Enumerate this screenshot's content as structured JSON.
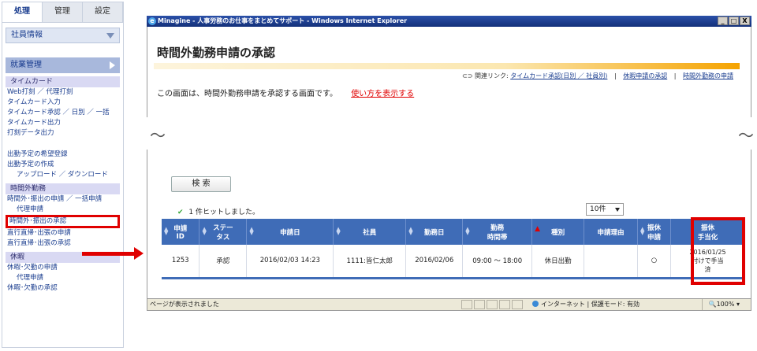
{
  "sidebar": {
    "tabs": [
      "処理",
      "管理",
      "設定"
    ],
    "employee_info": "社員情報",
    "work_management": "就業管理",
    "categories": {
      "timecard": "タイムカード",
      "overtime": "時間外勤務",
      "direct": "",
      "leave": "休暇"
    },
    "timecard_links": [
      "Web打刻 ／ 代理打刻",
      "タイムカード入力",
      "タイムカード承認 ／ 日別 ／ 一括",
      "タイムカード出力",
      "打刻データ出力"
    ],
    "schedule_links": [
      "出勤予定の希望登録",
      "出勤予定の作成",
      "アップロード ／ ダウンロード"
    ],
    "overtime_links": [
      "時間外･振出の申請 ／ 一括申請",
      "代理申請",
      "時間外･振出の承認",
      "直行直帰･出張の申請",
      "直行直帰･出張の承認"
    ],
    "leave_links": [
      "休暇･欠勤の申請",
      "代理申請",
      "休暇･欠勤の承認"
    ]
  },
  "window": {
    "title": "Minagine - 人事労務のお仕事をまとめてサポート - Windows Internet Explorer",
    "controls": [
      "_",
      "□",
      "X"
    ]
  },
  "page": {
    "title": "時間外勤務申請の承認",
    "related_label": "関連リンク:",
    "related_links": [
      "タイムカード承認(日別 ／ 社員別)",
      "休暇申請の承認",
      "時間外勤務の申請"
    ],
    "description": "この画面は、時間外勤務申請を承認する画面です。",
    "howto_link": "使い方を表示する"
  },
  "search": {
    "button_label": "検 索"
  },
  "results": {
    "hit_text": "1 件ヒットしました。",
    "per_page": "10件",
    "columns": [
      "申請\nID",
      "ステー\nタス",
      "申請日",
      "社員",
      "勤務日",
      "勤務\n時間帯",
      "種別",
      "申請理由",
      "振休\n申請",
      "振休\n手当化"
    ],
    "rows": [
      [
        "1253",
        "承認",
        "2016/02/03 14:23",
        "1111:皆仁太郎",
        "2016/02/06",
        "09:00 ～ 18:00",
        "休日出勤",
        "",
        "○",
        "2016/01/25\n付けで手当\n済"
      ]
    ]
  },
  "statusbar": {
    "text": "ページが表示されました",
    "zone": "インターネット | 保護モード: 有効",
    "zoom": "100%"
  },
  "colors": {
    "header_blue": "#3f6cb7",
    "highlight_red": "#e00000",
    "title_rule_orange": "#f5a300"
  }
}
